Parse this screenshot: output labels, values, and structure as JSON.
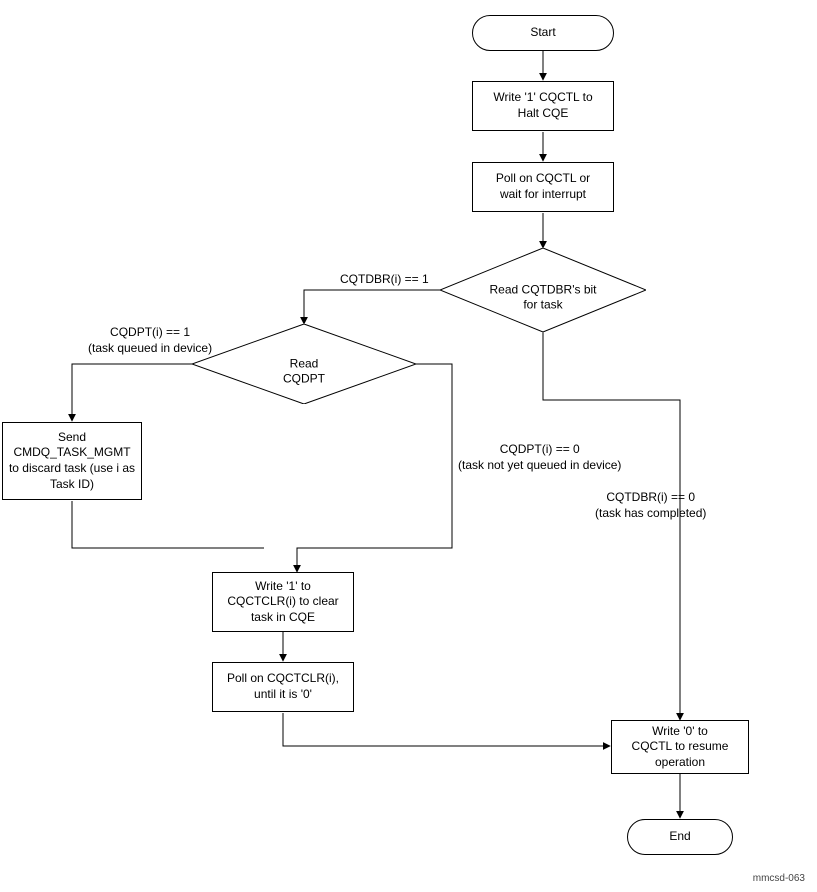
{
  "chart_data": {
    "type": "flowchart",
    "nodes": [
      {
        "id": "start",
        "kind": "terminal",
        "label": "Start"
      },
      {
        "id": "write_halt",
        "kind": "process",
        "label": "Write '1' CQCTL to Halt CQE"
      },
      {
        "id": "poll_cqctl",
        "kind": "process",
        "label": "Poll on CQCTL or wait for interrupt"
      },
      {
        "id": "read_cqtdbr",
        "kind": "decision",
        "label": "Read CQTDBR's bit for task"
      },
      {
        "id": "read_cqdpt",
        "kind": "decision",
        "label": "Read CQDPT"
      },
      {
        "id": "send_mgmt",
        "kind": "process",
        "label": "Send CMDQ_TASK_MGMT to discard task (use i as Task ID)"
      },
      {
        "id": "write_clear",
        "kind": "process",
        "label": "Write '1' to CQCTCLR(i) to clear task in CQE"
      },
      {
        "id": "poll_clear",
        "kind": "process",
        "label": "Poll on CQCTCLR(i), until it is '0'"
      },
      {
        "id": "resume",
        "kind": "process",
        "label": "Write '0' to CQCTL to resume operation"
      },
      {
        "id": "end",
        "kind": "terminal",
        "label": "End"
      }
    ],
    "edges": [
      {
        "from": "start",
        "to": "write_halt"
      },
      {
        "from": "write_halt",
        "to": "poll_cqctl"
      },
      {
        "from": "poll_cqctl",
        "to": "read_cqtdbr"
      },
      {
        "from": "read_cqtdbr",
        "to": "read_cqdpt",
        "label": "CQTDBR(i) == 1"
      },
      {
        "from": "read_cqtdbr",
        "to": "resume",
        "label": "CQTDBR(i) == 0 (task has completed)"
      },
      {
        "from": "read_cqdpt",
        "to": "send_mgmt",
        "label": "CQDPT(i) == 1 (task queued in device)"
      },
      {
        "from": "read_cqdpt",
        "to": "write_clear",
        "label": "CQDPT(i) == 0 (task not yet queued in device)"
      },
      {
        "from": "send_mgmt",
        "to": "write_clear"
      },
      {
        "from": "write_clear",
        "to": "poll_clear"
      },
      {
        "from": "poll_clear",
        "to": "resume"
      },
      {
        "from": "resume",
        "to": "end"
      }
    ]
  },
  "nodes": {
    "start": "Start",
    "write_halt": "Write '1' CQCTL to\nHalt CQE",
    "poll_cqctl": "Poll on CQCTL or\nwait for interrupt",
    "read_cqtdbr": "Read CQTDBR's bit\nfor task",
    "read_cqdpt": "Read\nCQDPT",
    "send_mgmt": "Send\nCMDQ_TASK_MGMT\nto discard task (use i as\nTask ID)",
    "write_clear": "Write '1' to\nCQCTCLR(i) to clear\ntask in CQE",
    "poll_clear": "Poll on CQCTCLR(i),\nuntil it is '0'",
    "resume": "Write '0' to\nCQCTL to resume\noperation",
    "end": "End"
  },
  "edge_labels": {
    "cqtdbr_1": "CQTDBR(i) == 1",
    "cqtdbr_0_a": "CQTDBR(i) == 0",
    "cqtdbr_0_b": "(task has completed)",
    "cqdpt_1_a": "CQDPT(i) == 1",
    "cqdpt_1_b": "(task queued in device)",
    "cqdpt_0_a": "CQDPT(i) == 0",
    "cqdpt_0_b": "(task not yet queued in device)"
  },
  "footer": "mmcsd-063"
}
